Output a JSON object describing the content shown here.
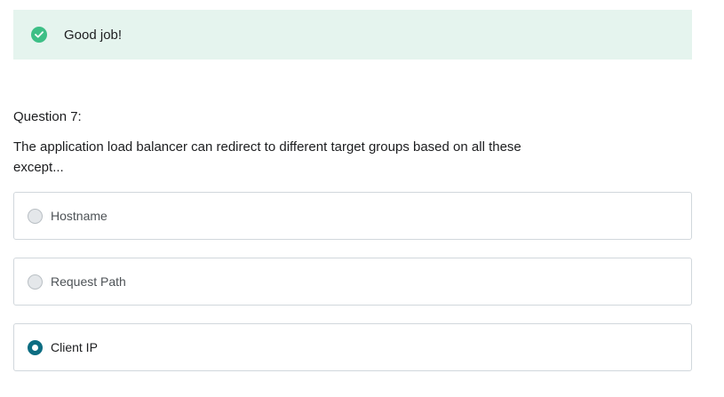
{
  "feedback": {
    "icon": "check-circle-icon",
    "text": "Good job!",
    "background": "#e5f4ee",
    "icon_color": "#3dbf86"
  },
  "question": {
    "label": "Question 7:",
    "text": "The application load balancer can redirect to different target groups based on all these except..."
  },
  "options": [
    {
      "label": "Hostname",
      "selected": false
    },
    {
      "label": "Request Path",
      "selected": false
    },
    {
      "label": "Client IP",
      "selected": true
    }
  ],
  "colors": {
    "accent": "#0d6d82",
    "border": "#d1d7dc"
  }
}
